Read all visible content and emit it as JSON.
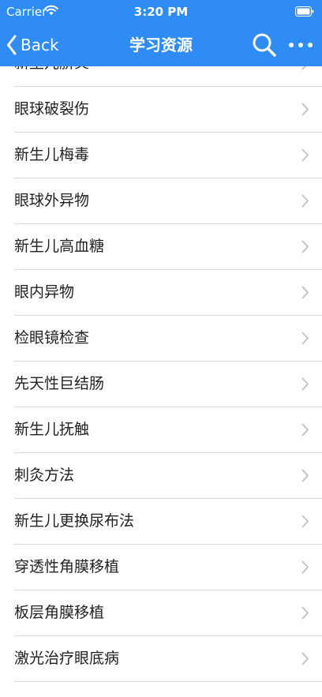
{
  "status": {
    "carrier": "Carrier",
    "time": "3:20 PM"
  },
  "nav": {
    "back_label": "Back",
    "title": "学习资源"
  },
  "icons": {
    "back": "chevron-left-icon",
    "search": "search-icon",
    "more": "ellipsis-icon",
    "row": "chevron-right-icon"
  },
  "colors": {
    "accent": "#2f8cf4",
    "chevron": "#c4c4c8",
    "separator": "#d9d9de"
  },
  "list": {
    "items": [
      {
        "label": "新生儿脐炎"
      },
      {
        "label": "眼球破裂伤"
      },
      {
        "label": "新生儿梅毒"
      },
      {
        "label": "眼球外异物"
      },
      {
        "label": "新生儿高血糖"
      },
      {
        "label": "眼内异物"
      },
      {
        "label": "检眼镜检查"
      },
      {
        "label": "先天性巨结肠"
      },
      {
        "label": "新生儿抚触"
      },
      {
        "label": "刺灸方法"
      },
      {
        "label": "新生儿更换尿布法"
      },
      {
        "label": "穿透性角膜移植"
      },
      {
        "label": "板层角膜移植"
      },
      {
        "label": "激光治疗眼底病"
      },
      {
        "label": ""
      }
    ]
  }
}
